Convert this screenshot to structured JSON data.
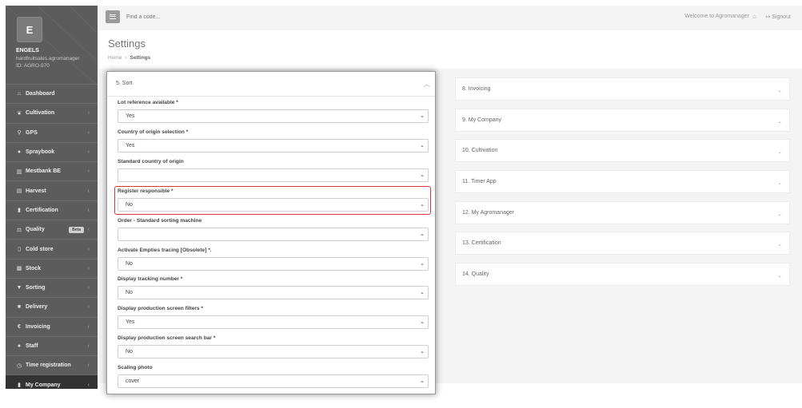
{
  "sidebar": {
    "logo_letter": "E",
    "company_name": "ENGELS",
    "company_sub": "hardfruitsales.agromanager",
    "company_id": "ID: AGRO-970",
    "items": [
      {
        "label": "Dashboard",
        "icon": "home-icon",
        "glyph": "⌂",
        "arrow": ""
      },
      {
        "label": "Cultivation",
        "icon": "leaf-icon",
        "glyph": "❦",
        "arrow": "‹"
      },
      {
        "label": "GPS",
        "icon": "map-pin-icon",
        "glyph": "⚲",
        "arrow": "‹"
      },
      {
        "label": "Spraybook",
        "icon": "drop-icon",
        "glyph": "●",
        "arrow": "‹"
      },
      {
        "label": "Mestbank BE",
        "icon": "bank-icon",
        "glyph": "▥",
        "arrow": "‹"
      },
      {
        "label": "Harvest",
        "icon": "basket-icon",
        "glyph": "▤",
        "arrow": "‹"
      },
      {
        "label": "Certification",
        "icon": "book-icon",
        "glyph": "▮",
        "arrow": "‹"
      },
      {
        "label": "Quality",
        "icon": "scale-icon",
        "glyph": "⚖",
        "arrow": "‹",
        "badge": "Beta"
      },
      {
        "label": "Cold store",
        "icon": "thermometer-icon",
        "glyph": "▯",
        "arrow": "‹"
      },
      {
        "label": "Stock",
        "icon": "table-icon",
        "glyph": "▦",
        "arrow": "‹"
      },
      {
        "label": "Sorting",
        "icon": "filter-icon",
        "glyph": "▼",
        "arrow": "‹"
      },
      {
        "label": "Delivery",
        "icon": "truck-icon",
        "glyph": "■",
        "arrow": "‹"
      },
      {
        "label": "Invoicing",
        "icon": "euro-icon",
        "glyph": "€",
        "arrow": "‹"
      },
      {
        "label": "Staff",
        "icon": "user-icon",
        "glyph": "●",
        "arrow": "‹"
      },
      {
        "label": "Time registration",
        "icon": "clock-icon",
        "glyph": "◷",
        "arrow": "‹"
      },
      {
        "label": "My Company",
        "icon": "building-icon",
        "glyph": "▮",
        "arrow": "‹"
      }
    ]
  },
  "topbar": {
    "search_placeholder": "Find a code...",
    "welcome": "Welcome to Agromanager",
    "signout": "Signout"
  },
  "header": {
    "title": "Settings",
    "breadcrumb_home": "Home",
    "breadcrumb_sep": "›",
    "breadcrumb_current": "Settings"
  },
  "sort_panel": {
    "title": "5. Sort",
    "fields": [
      {
        "label": "Lot reference available *",
        "value": "Yes"
      },
      {
        "label": "Country of origin selection *",
        "value": "Yes"
      },
      {
        "label": "Standard country of origin",
        "value": ""
      },
      {
        "label": "Register responsible *",
        "value": "No"
      },
      {
        "label": "Order - Standard sorting machine",
        "value": ""
      },
      {
        "label": "Activate Empties tracing [Obsolete] *.",
        "value": "No"
      },
      {
        "label": "Display tracking number *",
        "value": "No"
      },
      {
        "label": "Display production screen filters *",
        "value": "Yes"
      },
      {
        "label": "Display production screen search bar *",
        "value": "No"
      },
      {
        "label": "Scaling photo",
        "value": "cover"
      }
    ]
  },
  "accordion": [
    {
      "title": "8. Invoicing"
    },
    {
      "title": "9. My Company"
    },
    {
      "title": "10. Cultivation"
    },
    {
      "title": "11. Timer App"
    },
    {
      "title": "12. My Agromanager"
    },
    {
      "title": "13. Certification"
    },
    {
      "title": "14. Quality"
    }
  ],
  "colors": {
    "sidebar_bg": "#5c5c5c",
    "highlight_border": "#d9363e"
  }
}
